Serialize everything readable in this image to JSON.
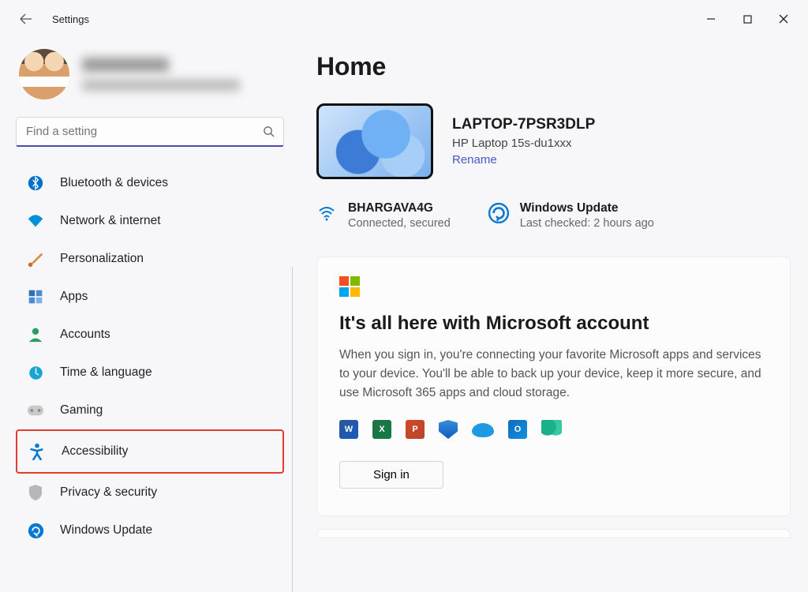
{
  "window": {
    "title": "Settings"
  },
  "search": {
    "placeholder": "Find a setting"
  },
  "sidebar": {
    "items": [
      {
        "label": "Bluetooth & devices"
      },
      {
        "label": "Network & internet"
      },
      {
        "label": "Personalization"
      },
      {
        "label": "Apps"
      },
      {
        "label": "Accounts"
      },
      {
        "label": "Time & language"
      },
      {
        "label": "Gaming"
      },
      {
        "label": "Accessibility"
      },
      {
        "label": "Privacy & security"
      },
      {
        "label": "Windows Update"
      }
    ]
  },
  "page": {
    "title": "Home",
    "device": {
      "name": "LAPTOP-7PSR3DLP",
      "model": "HP Laptop 15s-du1xxx",
      "rename": "Rename"
    },
    "wifi": {
      "name": "BHARGAVA4G",
      "status": "Connected, secured"
    },
    "update": {
      "name": "Windows Update",
      "status": "Last checked: 2 hours ago"
    },
    "card": {
      "heading": "It's all here with Microsoft account",
      "body": "When you sign in, you're connecting your favorite Microsoft apps and services to your device. You'll be able to back up your device, keep it more secure, and use Microsoft 365 apps and cloud storage.",
      "signin": "Sign in",
      "icons": {
        "word": "W",
        "excel": "X",
        "ppt": "P",
        "outlook": "O"
      }
    }
  }
}
